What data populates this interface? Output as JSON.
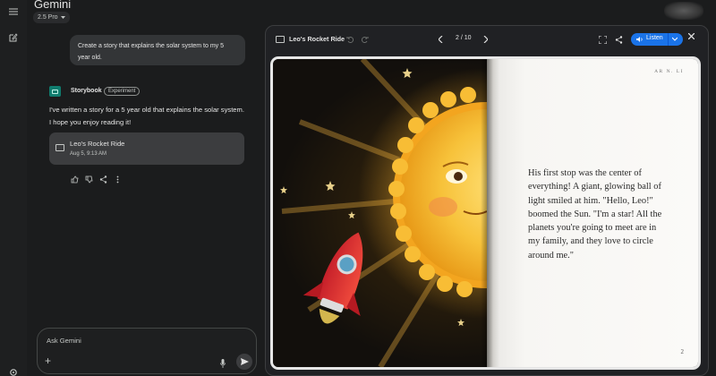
{
  "app": {
    "title": "Gemini",
    "model": "2.5 Pro"
  },
  "chat": {
    "user_prompt": "Create a story that explains the solar system to my 5 year old.",
    "assistant_name": "Storybook",
    "assistant_badge": "Experiment",
    "assistant_reply": "I've written a story for a 5 year old that explains the solar system. I hope you enjoy reading it!",
    "card": {
      "title": "Leo's Rocket Ride",
      "date": "Aug 5, 9:13 AM"
    },
    "feedback_icons": [
      "thumb-up-icon",
      "thumb-down-icon",
      "share-icon",
      "more-vert-icon"
    ]
  },
  "input": {
    "placeholder": "Ask Gemini"
  },
  "panel": {
    "title": "Leo's Rocket Ride",
    "page_indicator": "2 / 10",
    "listen_label": "Listen"
  },
  "book": {
    "header": "AR N. LI",
    "text": "His first stop was the center of everything! A giant, glowing ball of light smiled at him. \"Hello, Leo!\" boomed the Sun. \"I'm a star! All the planets you're going to meet are in my family, and they love to circle around me.\"",
    "page_number": "2",
    "illustration": "sun-and-rocket"
  },
  "colors": {
    "accent": "#1a73e8",
    "background": "#1b1c1d",
    "storybook_teal": "#0f7c6e"
  }
}
